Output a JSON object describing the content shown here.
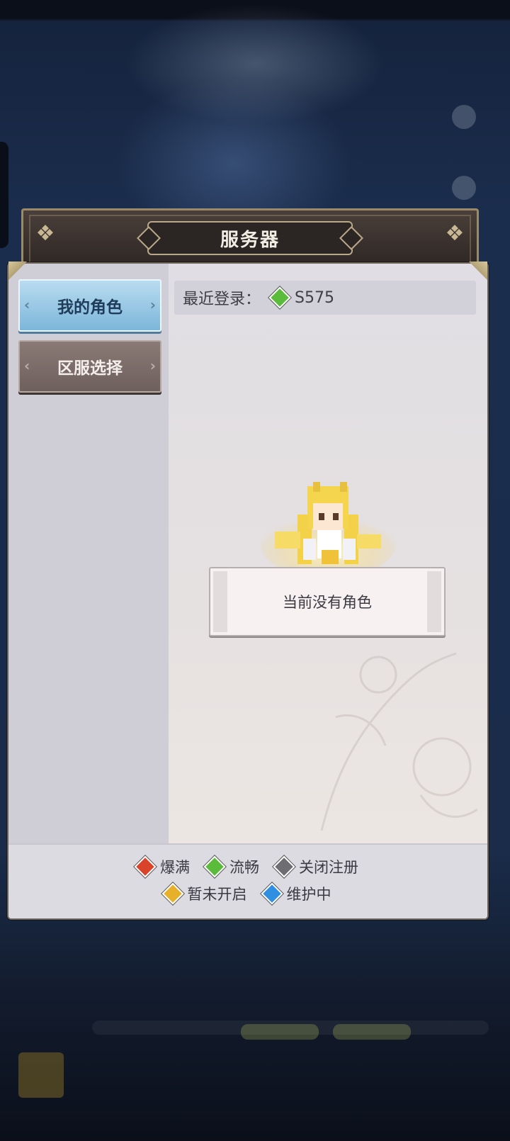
{
  "header": {
    "title": "服务器"
  },
  "sidebar": {
    "tabs": [
      {
        "label": "我的角色",
        "active": true
      },
      {
        "label": "区服选择",
        "active": false
      }
    ]
  },
  "recent": {
    "label": "最近登录：",
    "server": "S575",
    "status_icon": "gem-green"
  },
  "empty_state": {
    "message": "当前没有角色"
  },
  "legend": {
    "items": [
      {
        "label": "爆满",
        "icon": "gem-red",
        "color": "#d9432a"
      },
      {
        "label": "流畅",
        "icon": "gem-green",
        "color": "#5bbb3a"
      },
      {
        "label": "关闭注册",
        "icon": "gem-gray",
        "color": "#6e6e72"
      },
      {
        "label": "暂未开启",
        "icon": "gem-yellow",
        "color": "#e7b02b"
      },
      {
        "label": "维护中",
        "icon": "gem-blue",
        "color": "#2f8fe0"
      }
    ]
  }
}
